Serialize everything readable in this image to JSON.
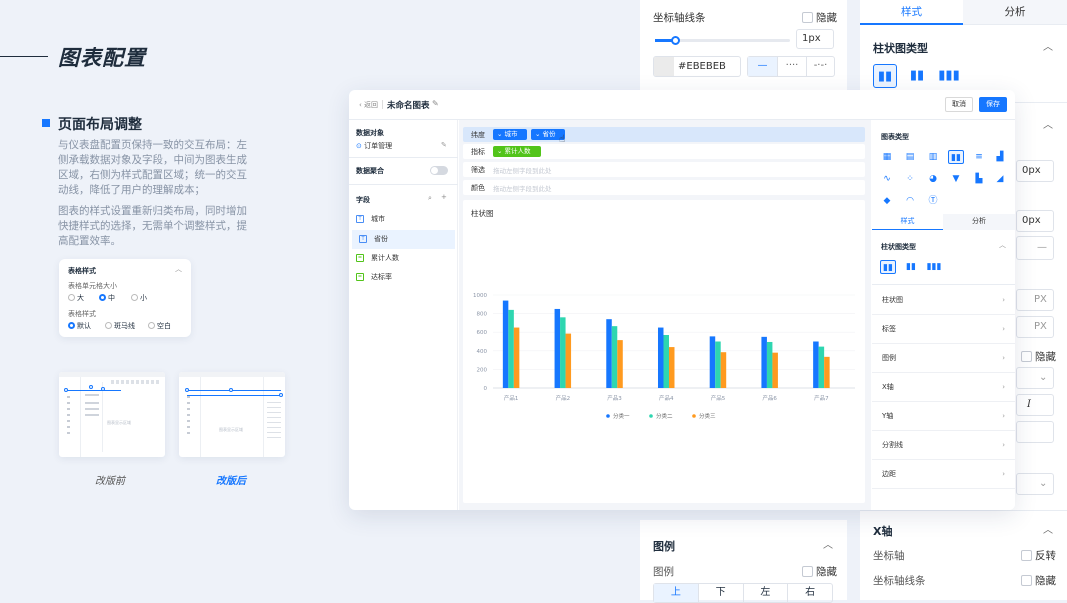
{
  "slide": {
    "title": "图表配置",
    "section_title": "页面布局调整",
    "para1": "与仪表盘配置页保持一致的交互布局：左侧承载数据对象及字段，中间为图表生成区域，右侧为样式配置区域；统一的交互动线，降低了用户的理解成本；",
    "para2": "图表的样式设置重新归类布局，同时增加快捷样式的选择，无需单个调整样式，提高配置效率。",
    "before_label": "改版前",
    "after_label": "改版后"
  },
  "table_card": {
    "title": "表格样式",
    "size_label": "表格单元格大小",
    "sizes": [
      "大",
      "中",
      "小"
    ],
    "style_label": "表格样式",
    "styles": [
      "默认",
      "斑马线",
      "空白"
    ]
  },
  "thumb_text": "图表显示区域",
  "window": {
    "back": "返回",
    "chart_name": "未命名图表",
    "cancel": "取消",
    "save": "保存",
    "data_object_label": "数据对象",
    "data_object_value": "订单管理",
    "merge_label": "数据聚合",
    "fields_label": "字段",
    "fields": [
      {
        "name": "城市",
        "color": "#4a8ef5",
        "icon": "T"
      },
      {
        "name": "省份",
        "color": "#4a8ef5",
        "icon": "T"
      },
      {
        "name": "累计人数",
        "color": "#52c41a",
        "icon": "="
      },
      {
        "name": "达标率",
        "color": "#52c41a",
        "icon": "="
      }
    ],
    "rows": [
      {
        "label": "纬度",
        "chips": [
          {
            "text": "城市",
            "color": "#1677ff"
          },
          {
            "text": "省份",
            "color": "#1677ff"
          }
        ]
      },
      {
        "label": "指标",
        "chips": [
          {
            "text": "累计人数",
            "color": "#52c41a"
          }
        ]
      },
      {
        "label": "筛选",
        "placeholder": "拖动左侧字段到此处"
      },
      {
        "label": "颜色",
        "placeholder": "拖动左侧字段到此处"
      }
    ],
    "chart_title": "柱状图",
    "panel": {
      "chart_type_label": "图表类型",
      "tabs": [
        "样式",
        "分析"
      ],
      "bar_type_label": "柱状图类型",
      "menu": [
        "柱状图",
        "标签",
        "图例",
        "X轴",
        "Y轴",
        "分割线",
        "边距"
      ]
    }
  },
  "chart_data": {
    "type": "bar",
    "categories": [
      "产品1",
      "产品2",
      "产品3",
      "产品4",
      "产品5",
      "产品6",
      "产品7"
    ],
    "ylim": [
      0,
      1000
    ],
    "yticks": [
      "0",
      "200",
      "400",
      "600",
      "800",
      "1000"
    ],
    "series": [
      {
        "name": "分类一",
        "color": "#1677ff",
        "values": [
          940,
          850,
          740,
          650,
          555,
          550,
          500
        ]
      },
      {
        "name": "分类二",
        "color": "#2ed6b0",
        "values": [
          840,
          760,
          665,
          570,
          500,
          495,
          445
        ]
      },
      {
        "name": "分类三",
        "color": "#ff9a1f",
        "values": [
          650,
          585,
          515,
          440,
          385,
          380,
          335
        ]
      }
    ],
    "legend_position": "bottom"
  },
  "bg_left_panel": {
    "grid_line_label": "坐标轴线条",
    "hide_label": "隐藏",
    "width_value": "1px",
    "color_value": "#EBEBEB",
    "legend_label": "图例",
    "legend_sub": "图例",
    "positions": [
      "上",
      "下",
      "左",
      "右"
    ]
  },
  "bg_right_panel": {
    "tabs": [
      "样式",
      "分析"
    ],
    "bar_type_label": "柱状图类型",
    "padding_value_1": "0px",
    "padding_value_2": "0px",
    "unit_1": "PX",
    "unit_2": "PX",
    "hide_label": "隐藏",
    "italic": "I",
    "xaxis_label": "X轴",
    "axis_label": "坐标轴",
    "reverse_label": "反转",
    "axis_line_label": "坐标轴线条",
    "hide_label_2": "隐藏"
  }
}
